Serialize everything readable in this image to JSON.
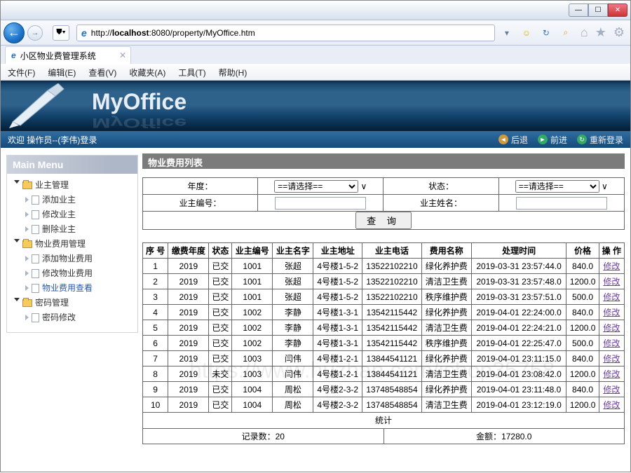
{
  "browser": {
    "url": "http://localhost:8080/property/MyOffice.htm",
    "url_host": "localhost",
    "tab_title": "小区物业费管理系统"
  },
  "ie_menu": [
    "文件(F)",
    "编辑(E)",
    "查看(V)",
    "收藏夹(A)",
    "工具(T)",
    "帮助(H)"
  ],
  "app": {
    "brand": "MyOffice",
    "welcome": "欢迎 操作员--(李伟)登录",
    "actions": {
      "back": "后退",
      "forward": "前进",
      "relogin": "重新登录"
    }
  },
  "sidebar": {
    "title": "Main Menu",
    "nodes": [
      {
        "label": "业主管理",
        "children": [
          {
            "label": "添加业主"
          },
          {
            "label": "修改业主"
          },
          {
            "label": "删除业主"
          }
        ]
      },
      {
        "label": "物业费用管理",
        "children": [
          {
            "label": "添加物业费用"
          },
          {
            "label": "修改物业费用"
          },
          {
            "label": "物业费用查看",
            "selected": true
          }
        ]
      },
      {
        "label": "密码管理",
        "children": [
          {
            "label": "密码修改"
          }
        ]
      }
    ]
  },
  "panel_title": "物业费用列表",
  "filter": {
    "year_label": "年度：",
    "year_placeholder": "==请选择==",
    "status_label": "状态：",
    "status_placeholder": "==请选择==",
    "ownerId_label": "业主编号：",
    "ownerName_label": "业主姓名：",
    "query_btn": "查 询"
  },
  "table": {
    "headers": [
      "序 号",
      "缴费年度",
      "状态",
      "业主编号",
      "业主名字",
      "业主地址",
      "业主电话",
      "费用名称",
      "处理时间",
      "价格",
      "操 作"
    ],
    "rows": [
      [
        "1",
        "2019",
        "已交",
        "1001",
        "张超",
        "4号楼1-5-2",
        "13522102210",
        "绿化养护费",
        "2019-03-31 23:57:44.0",
        "840.0",
        "修改"
      ],
      [
        "2",
        "2019",
        "已交",
        "1001",
        "张超",
        "4号楼1-5-2",
        "13522102210",
        "清洁卫生费",
        "2019-03-31 23:57:48.0",
        "1200.0",
        "修改"
      ],
      [
        "3",
        "2019",
        "已交",
        "1001",
        "张超",
        "4号楼1-5-2",
        "13522102210",
        "秩序维护费",
        "2019-03-31 23:57:51.0",
        "500.0",
        "修改"
      ],
      [
        "4",
        "2019",
        "已交",
        "1002",
        "李静",
        "4号楼1-3-1",
        "13542115442",
        "绿化养护费",
        "2019-04-01 22:24:00.0",
        "840.0",
        "修改"
      ],
      [
        "5",
        "2019",
        "已交",
        "1002",
        "李静",
        "4号楼1-3-1",
        "13542115442",
        "清洁卫生费",
        "2019-04-01 22:24:21.0",
        "1200.0",
        "修改"
      ],
      [
        "6",
        "2019",
        "已交",
        "1002",
        "李静",
        "4号楼1-3-1",
        "13542115442",
        "秩序维护费",
        "2019-04-01 22:25:47.0",
        "500.0",
        "修改"
      ],
      [
        "7",
        "2019",
        "已交",
        "1003",
        "闫伟",
        "4号楼1-2-1",
        "13844541121",
        "绿化养护费",
        "2019-04-01 23:11:15.0",
        "840.0",
        "修改"
      ],
      [
        "8",
        "2019",
        "未交",
        "1003",
        "闫伟",
        "4号楼1-2-1",
        "13844541121",
        "清洁卫生费",
        "2019-04-01 23:08:42.0",
        "1200.0",
        "修改"
      ],
      [
        "9",
        "2019",
        "已交",
        "1004",
        "周松",
        "4号楼2-3-2",
        "13748548854",
        "绿化养护费",
        "2019-04-01 23:11:48.0",
        "840.0",
        "修改"
      ],
      [
        "10",
        "2019",
        "已交",
        "1004",
        "周松",
        "4号楼2-3-2",
        "13748548854",
        "清洁卫生费",
        "2019-04-01 23:12:19.0",
        "1200.0",
        "修改"
      ]
    ],
    "summary_label": "统计",
    "record_count_label": "记录数：",
    "record_count": "20",
    "amount_label": "金额：",
    "amount": "17280.0"
  },
  "watermark": "https://www.huzhan.com/ishop35758"
}
